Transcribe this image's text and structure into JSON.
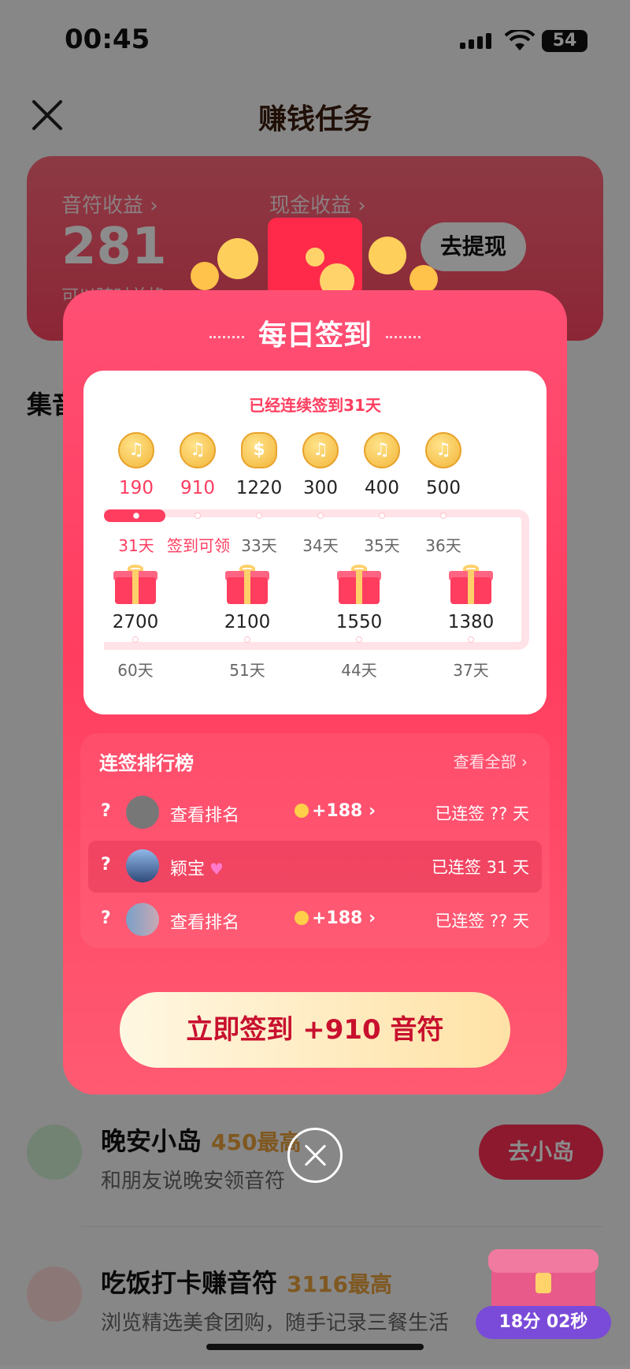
{
  "status_bar": {
    "time": "00:45",
    "battery": "54"
  },
  "nav": {
    "title": "赚钱任务"
  },
  "earnings": {
    "note_label": "音符收益 ›",
    "note_value": "281",
    "cash_label": "现金收益 ›",
    "cash_value": "",
    "withdraw_label": "去提现",
    "sub_text": "可以随时兑换"
  },
  "section_title": "集音符",
  "tasks": [
    {
      "title": "晚安小岛",
      "reward": "450最高",
      "desc": "和朋友说晚安领音符",
      "button": "去小岛"
    },
    {
      "title": "吃饭打卡赚音符",
      "reward": "3116最高",
      "desc": "浏览精选美食团购，随手记录三餐生活",
      "button": ""
    }
  ],
  "modal": {
    "title": "每日签到",
    "streak_text": "已经连续签到31天",
    "rewards_row1": [
      {
        "amount": "190",
        "day": "31天"
      },
      {
        "amount": "910",
        "day": "签到可领"
      },
      {
        "amount": "1220",
        "day": "33天"
      },
      {
        "amount": "300",
        "day": "34天"
      },
      {
        "amount": "400",
        "day": "35天"
      },
      {
        "amount": "500",
        "day": "36天"
      }
    ],
    "rewards_row2": [
      {
        "amount": "2700",
        "day": "60天"
      },
      {
        "amount": "2100",
        "day": "51天"
      },
      {
        "amount": "1550",
        "day": "44天"
      },
      {
        "amount": "1380",
        "day": "37天"
      }
    ],
    "ranking": {
      "title": "连签排行榜",
      "view_all": "查看全部 ›",
      "rows": [
        {
          "rank": "?",
          "name": "查看排名",
          "bonus": "+188 ›",
          "streak": "已连签 ?? 天"
        },
        {
          "rank": "?",
          "name": "颖宝",
          "bonus": "",
          "streak": "已连签 31 天"
        },
        {
          "rank": "?",
          "name": "查看排名",
          "bonus": "+188 ›",
          "streak": "已连签 ?? 天"
        }
      ]
    },
    "sign_button": "立即签到 +910 音符"
  },
  "timer": "18分 02秒",
  "colors": {
    "accent": "#ff3d5f",
    "button_gold": "#ffe2a6"
  }
}
